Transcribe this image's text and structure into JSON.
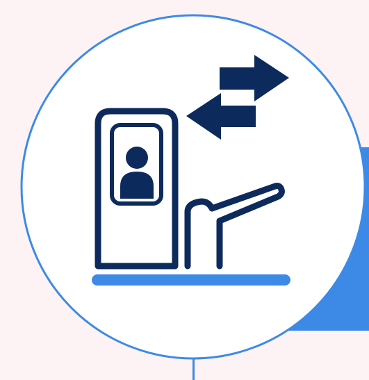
{
  "icon": {
    "name": "toll-gate-barrier-icon",
    "description_label": "",
    "elements": {
      "booth": "toll-booth-icon",
      "person": "person-icon",
      "barrier": "barrier-arm-icon",
      "arrow_right": "arrow-right-icon",
      "arrow_left": "arrow-left-icon",
      "ground": "ground-line"
    }
  },
  "colors": {
    "background": "#fdf3f5",
    "circle_fill": "#ffffff",
    "circle_stroke": "#3d8ae6",
    "accent": "#3d8ae6",
    "icon": "#0c2a5c"
  }
}
